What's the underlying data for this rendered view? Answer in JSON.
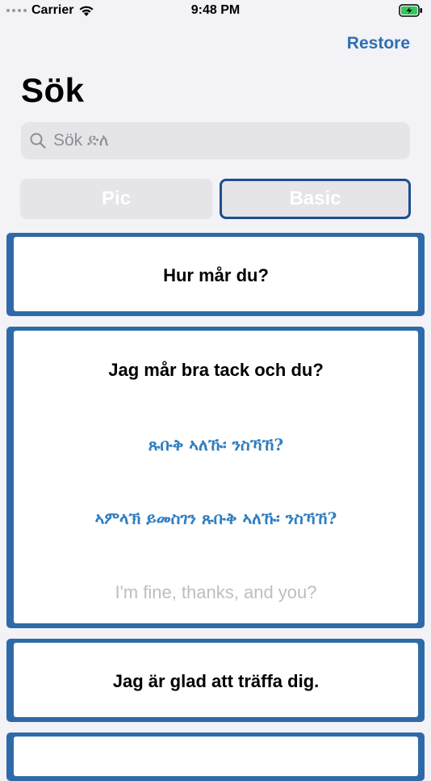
{
  "status_bar": {
    "carrier": "Carrier",
    "time": "9:48 PM"
  },
  "header": {
    "restore_label": "Restore",
    "title": "Sök"
  },
  "search": {
    "placeholder": "Sök ድለ"
  },
  "segments": {
    "pic_label": "Pic",
    "basic_label": "Basic",
    "selected": "Basic"
  },
  "cards": [
    {
      "swedish": "Hur mår du?"
    },
    {
      "swedish": "Jag mår bra tack och du?",
      "tigrinya_1": "ጹቡቅ ኣለኹ፡ ንስኻኸ?",
      "tigrinya_2": "ኣምላኽ ይመስገን ጹቡቅ ኣለኹ፡ ንስኻኸ?",
      "english": "I'm fine, thanks, and you?"
    },
    {
      "swedish": "Jag är glad att träffa dig."
    }
  ],
  "colors": {
    "accent": "#2f6fb2",
    "card_border": "#2f6aa8",
    "background": "#f2f2f7"
  }
}
